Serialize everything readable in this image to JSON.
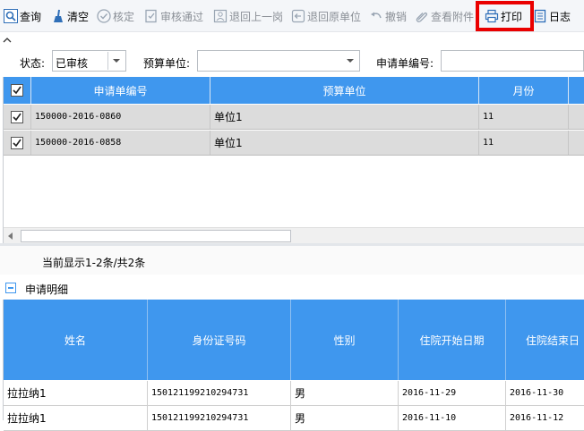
{
  "toolbar": {
    "query": "查询",
    "clear": "清空",
    "verify": "核定",
    "approve": "审核通过",
    "return_prev": "退回上一岗",
    "return_origin": "退回原单位",
    "revoke": "撤销",
    "attachments": "查看附件",
    "print": "打印",
    "log": "日志"
  },
  "filters": {
    "status_label": "状态:",
    "status_value": "已审核",
    "budget_unit_label": "预算单位:",
    "budget_unit_value": "",
    "request_no_label": "申请单编号:",
    "request_no_value": ""
  },
  "request_grid": {
    "columns": [
      "申请单编号",
      "预算单位",
      "月份"
    ],
    "rows": [
      {
        "checked": true,
        "request_no": "150000-2016-0860",
        "unit": "单位1",
        "month": "11"
      },
      {
        "checked": true,
        "request_no": "150000-2016-0858",
        "unit": "单位1",
        "month": "11"
      }
    ],
    "pager_text": "当前显示1-2条/共2条"
  },
  "detail": {
    "section_title": "申请明细",
    "columns": [
      "姓名",
      "身份证号码",
      "性别",
      "住院开始日期",
      "住院结束日"
    ],
    "rows": [
      {
        "name": "拉拉纳1",
        "id_no": "150121199210294731",
        "gender": "男",
        "start": "2016-11-29",
        "end": "2016-11-30"
      },
      {
        "name": "拉拉纳1",
        "id_no": "150121199210294731",
        "gender": "男",
        "start": "2016-11-10",
        "end": "2016-11-12"
      }
    ]
  },
  "colors": {
    "header_blue": "#3f97ee",
    "highlight_red": "#ea0000"
  }
}
